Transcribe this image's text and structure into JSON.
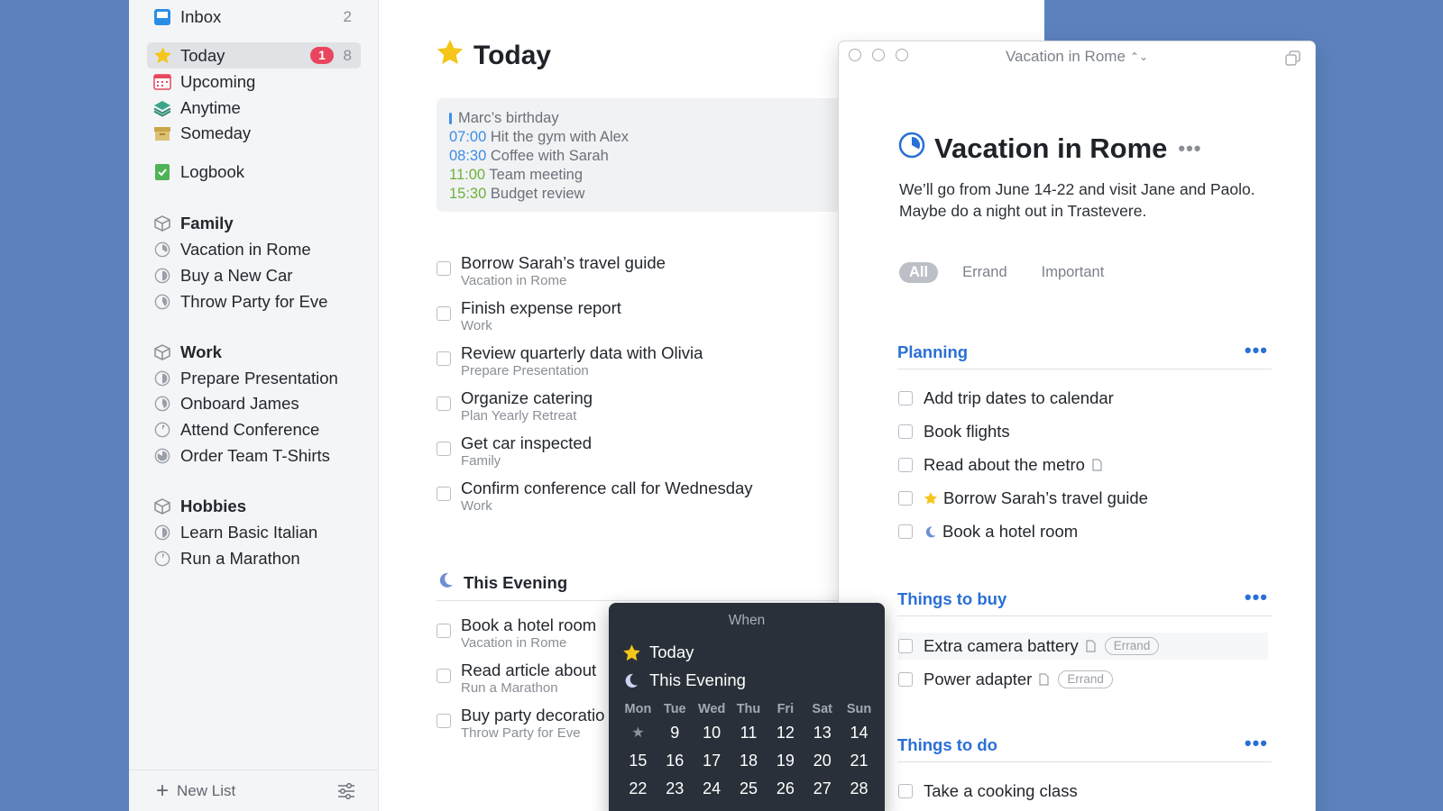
{
  "sidebar": {
    "nav": [
      {
        "label": "Inbox",
        "count": "2"
      },
      {
        "label": "Today",
        "badge": "1",
        "count": "8"
      },
      {
        "label": "Upcoming"
      },
      {
        "label": "Anytime"
      },
      {
        "label": "Someday"
      },
      {
        "label": "Logbook"
      }
    ],
    "areas": [
      {
        "name": "Family",
        "projects": [
          "Vacation in Rome",
          "Buy a New Car",
          "Throw Party for Eve"
        ]
      },
      {
        "name": "Work",
        "projects": [
          "Prepare Presentation",
          "Onboard James",
          "Attend Conference",
          "Order Team T-Shirts"
        ]
      },
      {
        "name": "Hobbies",
        "projects": [
          "Learn Basic Italian",
          "Run a Marathon"
        ]
      }
    ],
    "footer": {
      "new_list": "New List"
    }
  },
  "today": {
    "title": "Today",
    "calendar": {
      "birthday": "Marc’s birthday",
      "events": [
        {
          "time": "07:00",
          "title": "Hit the gym with Alex",
          "color": "#3d8ee6"
        },
        {
          "time": "08:30",
          "title": "Coffee with Sarah",
          "color": "#3d8ee6"
        },
        {
          "time": "11:00",
          "title": "Team meeting",
          "color": "#6cb33a"
        },
        {
          "time": "15:30",
          "title": "Budget review",
          "color": "#6cb33a"
        }
      ]
    },
    "tasks": [
      {
        "title": "Borrow Sarah’s travel guide",
        "project": "Vacation in Rome"
      },
      {
        "title": "Finish expense report",
        "project": "Work"
      },
      {
        "title": "Review quarterly data with Olivia",
        "project": "Prepare Presentation"
      },
      {
        "title": "Organize catering",
        "project": "Plan Yearly Retreat"
      },
      {
        "title": "Get car inspected",
        "project": "Family"
      },
      {
        "title": "Confirm conference call for Wednesday",
        "project": "Work"
      }
    ],
    "evening": {
      "title": "This Evening",
      "tasks": [
        {
          "title": "Book a hotel room",
          "project": "Vacation in Rome"
        },
        {
          "title": "Read article about",
          "project": "Run a Marathon"
        },
        {
          "title": "Buy party decoratio",
          "project": "Throw Party for Eve"
        }
      ]
    }
  },
  "project": {
    "window_title": "Vacation in Rome",
    "title": "Vacation in Rome",
    "notes": "We’ll go from June 14-22 and visit Jane and Paolo. Maybe do a night out in Trastevere.",
    "tags": [
      "All",
      "Errand",
      "Important"
    ],
    "headings": [
      {
        "title": "Planning",
        "tasks": [
          "Add trip dates to calendar",
          "Book flights",
          "Read about the metro",
          "Borrow Sarah’s travel guide",
          "Book a hotel room"
        ]
      },
      {
        "title": "Things to buy",
        "tasks": [
          "Extra camera battery",
          "Power adapter"
        ],
        "tag": "Errand"
      },
      {
        "title": "Things to do",
        "tasks": [
          "Take a cooking class"
        ]
      }
    ]
  },
  "when_popover": {
    "title": "When",
    "options": [
      "Today",
      "This Evening"
    ],
    "day_names": [
      "Mon",
      "Tue",
      "Wed",
      "Thu",
      "Fri",
      "Sat",
      "Sun"
    ],
    "dates": [
      "★",
      "9",
      "10",
      "11",
      "12",
      "13",
      "14",
      "15",
      "16",
      "17",
      "18",
      "19",
      "20",
      "21",
      "22",
      "23",
      "24",
      "25",
      "26",
      "27",
      "28"
    ]
  },
  "colors": {
    "accent": "#2a6fd6",
    "badge": "#e8465f",
    "desktop": "#5c82bd",
    "star": "#f5c518"
  }
}
